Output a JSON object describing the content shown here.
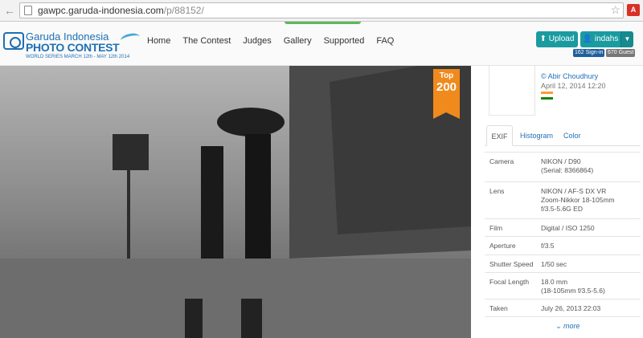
{
  "browser": {
    "url_host": "gawpc.garuda-indonesia.com",
    "url_path": "/p/88152/",
    "ext_label": "A"
  },
  "site": {
    "logo_name": "Garuda Indonesia",
    "logo_contest": "PHOTO CONTEST",
    "logo_tagline": "WORLD SERIES  MARCH 12th - MAY 12th 2014",
    "nav": [
      "Home",
      "The Contest",
      "Judges",
      "Gallery",
      "Supported",
      "FAQ"
    ],
    "upload_label": "Upload",
    "user_label": "indahs",
    "signin_badge": "162 Sign-in",
    "guest_badge": "670 Guest"
  },
  "photo": {
    "ribbon_label": "Top",
    "ribbon_rank": "200"
  },
  "author": {
    "name": "© Abir Choudhury",
    "date": "April 12, 2014 12:20",
    "flag_colors": [
      "#ff9933",
      "#ffffff",
      "#138808"
    ]
  },
  "tabs": [
    "EXIF",
    "Histogram",
    "Color"
  ],
  "exif": [
    {
      "label": "Camera",
      "value": "NIKON / D90\n(Serial: 8366864)"
    },
    {
      "label": "Lens",
      "value": "NIKON / AF-S DX VR\nZoom-Nikkor 18-105mm\nf/3.5-5.6G ED"
    },
    {
      "label": "Film",
      "value": "Digital / ISO 1250"
    },
    {
      "label": "Aperture",
      "value": "f/3.5"
    },
    {
      "label": "Shutter Speed",
      "value": "1/50 sec"
    },
    {
      "label": "Focal Length",
      "value": "18.0 mm\n(18-105mm f/3.5-5.6)"
    },
    {
      "label": "Taken",
      "value": "July 26, 2013 22:03"
    }
  ],
  "more_label": "more",
  "colors": {
    "accent_teal": "#1a9ba0",
    "link_blue": "#1f6fb6",
    "ribbon_orange": "#f08a1c"
  }
}
